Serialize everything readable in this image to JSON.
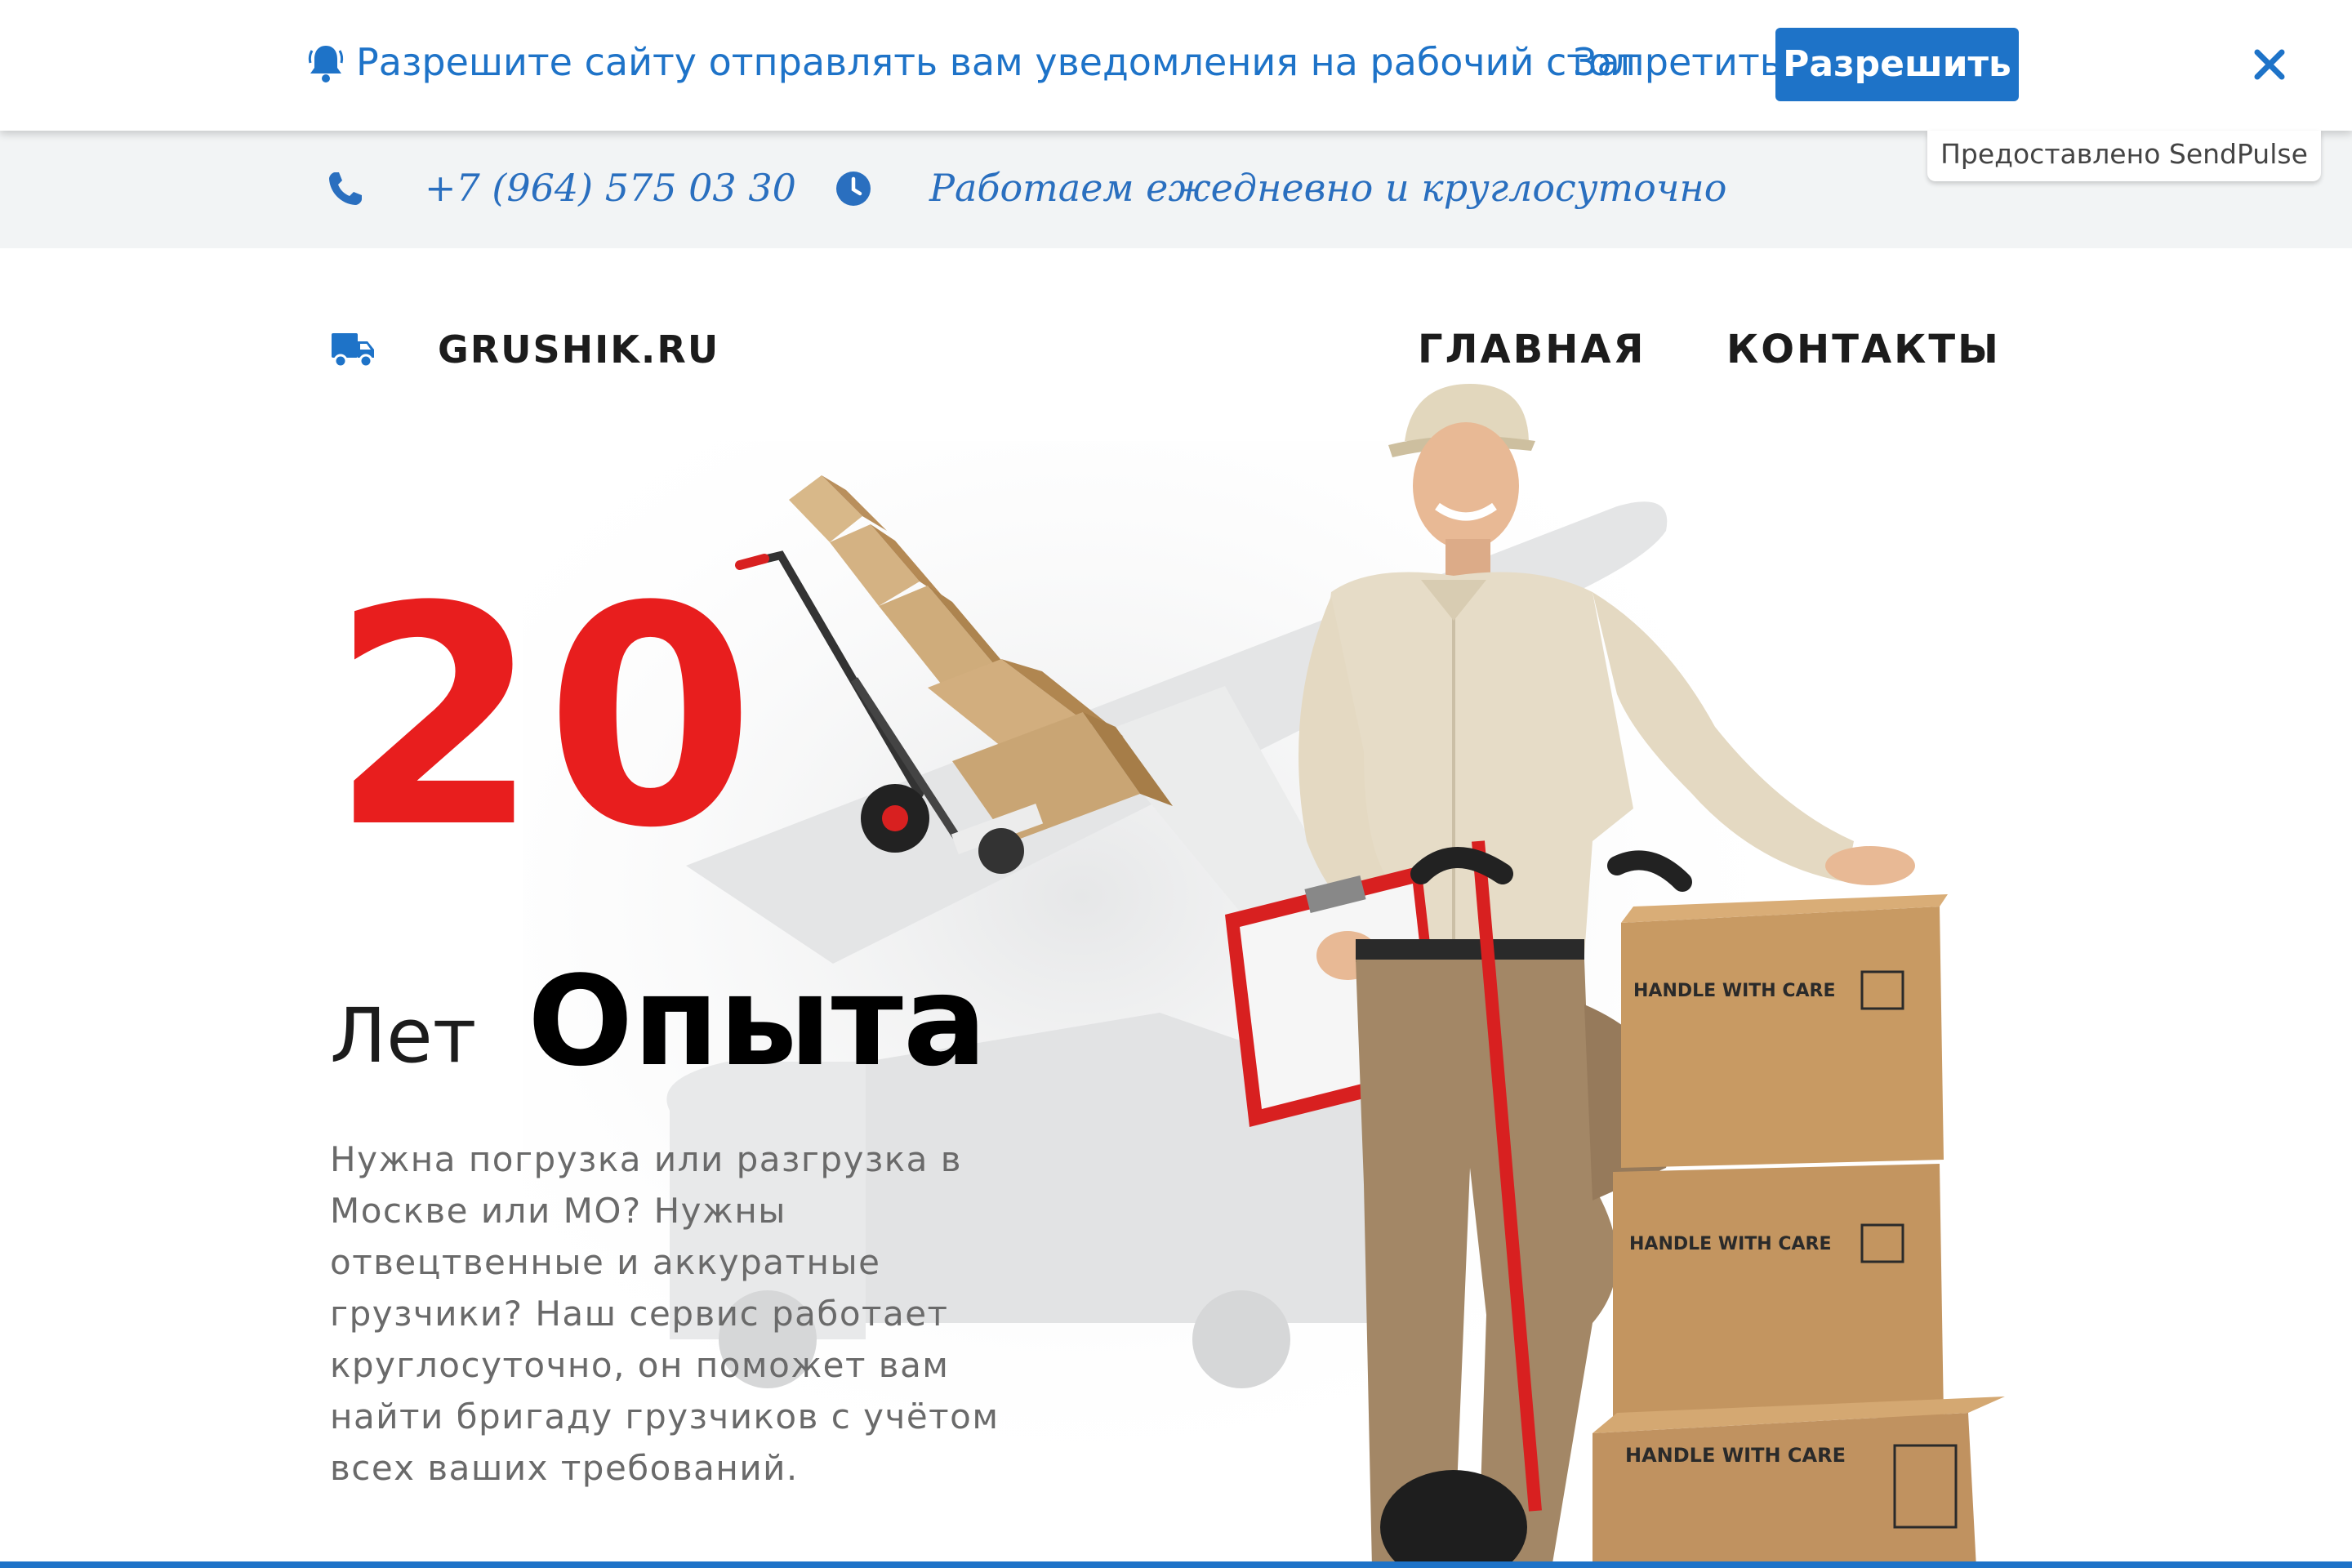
{
  "notification": {
    "message": "Разрешите сайту отправлять вам уведомления на рабочий стол",
    "deny_label": "Запретить",
    "allow_label": "Разрешить",
    "credit": "Предоставлено SendPulse",
    "icons": {
      "bell": "bell-icon",
      "close": "close-icon"
    },
    "accent_color": "#1e73c8"
  },
  "contact_strip": {
    "phone": "+7 (964) 575 03 30",
    "hours": "Работаем ежедневно и круглосуточно",
    "icons": {
      "phone": "phone-icon",
      "clock": "clock-icon"
    }
  },
  "header": {
    "logo_text": "GRUSHIK.RU",
    "logo_icon": "truck-icon",
    "nav": {
      "home": "ГЛАВНАЯ",
      "contacts": "КОНТАКТЫ"
    }
  },
  "hero": {
    "number": "20",
    "years_light": "Лет",
    "years_bold": "Опыта",
    "description": "Нужна погрузка или разгрузка в Москве или МО? Нужны отвецтвенные и аккуратные грузчики? Наш сервис работает круглосуточно, он поможет вам найти бригаду грузчиков с учётом всех ваших требований.",
    "box_label": "HANDLE WITH CARE",
    "number_color": "#e81e1e"
  }
}
